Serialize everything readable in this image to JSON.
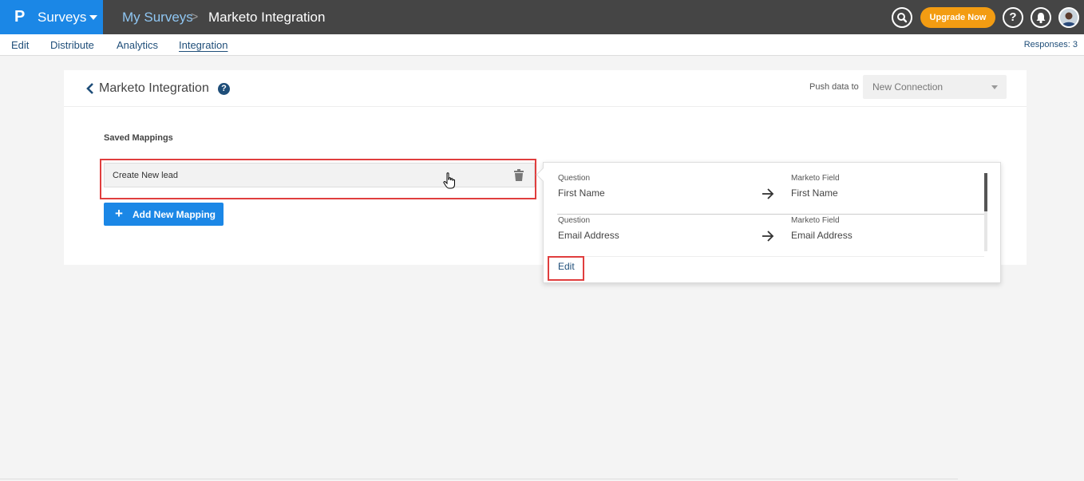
{
  "topbar": {
    "brand_logo": "P",
    "brand_name": "Surveys",
    "breadcrumb_parent": "My Surveys",
    "breadcrumb_separator": ">",
    "breadcrumb_current": "Marketo Integration",
    "upgrade_label": "Upgrade Now",
    "help_label": "?"
  },
  "subnav": {
    "items": [
      "Edit",
      "Distribute",
      "Analytics",
      "Integration"
    ],
    "active": "Integration",
    "responses": "Responses: 3"
  },
  "card": {
    "title": "Marketo Integration",
    "help_label": "?",
    "push_label": "Push data to",
    "push_value": "New Connection",
    "saved_label": "Saved Mappings",
    "mapping_name": "Create New lead",
    "add_label": "Add New Mapping",
    "add_plus": "+"
  },
  "popover": {
    "rows": [
      {
        "q_label": "Question",
        "q_value": "First Name",
        "mf_label": "Marketo Field",
        "mf_value": "First Name"
      },
      {
        "q_label": "Question",
        "q_value": "Email Address",
        "mf_label": "Marketo Field",
        "mf_value": "Email Address"
      }
    ],
    "edit_label": "Edit"
  },
  "colors": {
    "brand_blue": "#1b87e6",
    "topbar": "#454545",
    "upgrade": "#f39c12",
    "highlight": "#e03e3e",
    "link": "#1f4e79"
  },
  "icons": [
    "search-icon",
    "bell-icon",
    "help-icon",
    "avatar",
    "back-chevron-icon",
    "trash-icon",
    "hand-cursor-icon",
    "arrow-right-icon",
    "dropdown-caret-icon"
  ]
}
